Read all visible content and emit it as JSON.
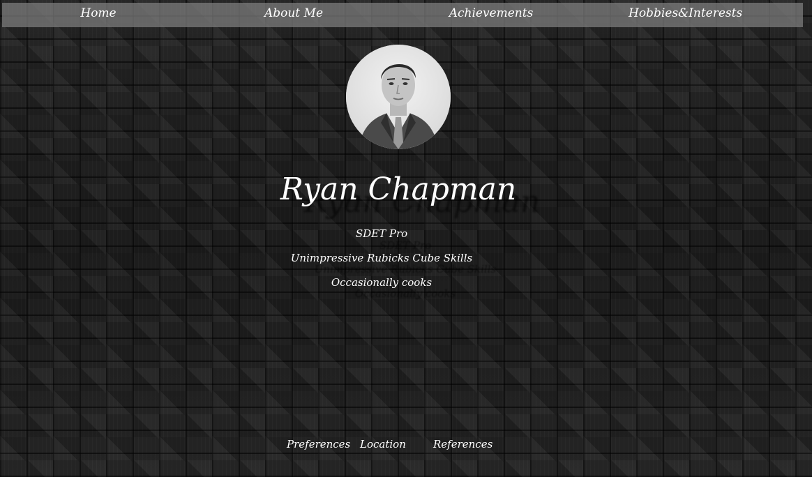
{
  "nav": {
    "items": [
      {
        "label": "Home"
      },
      {
        "label": "About Me"
      },
      {
        "label": "Achievements"
      },
      {
        "label": "Hobbies&Interests"
      }
    ]
  },
  "profile": {
    "name": "Ryan Chapman",
    "taglines": [
      "SDET Pro",
      "Unimpressive Rubicks Cube Skills",
      "Occasionally cooks"
    ]
  },
  "footer": {
    "links": [
      {
        "label": "Preferences"
      },
      {
        "label": "Location"
      },
      {
        "label": "References"
      }
    ]
  },
  "colors": {
    "text": "#ffffff",
    "navbar": "#808080",
    "background": "#1f1f1f"
  }
}
